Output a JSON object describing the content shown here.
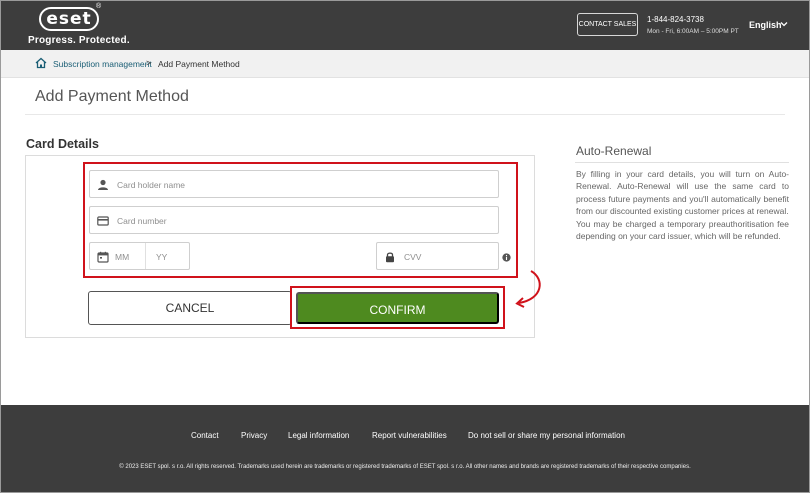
{
  "header": {
    "logo_text": "eset",
    "logo_registered": "®",
    "tagline": "Progress. Protected.",
    "contact_sales_label": "CONTACT SALES",
    "phone": "1-844-824-3738",
    "hours": "Mon - Fri, 6:00AM – 5:00PM PT",
    "language": "English"
  },
  "breadcrumb": {
    "link_label": "Subscription management",
    "separator": ">",
    "current": "Add Payment Method"
  },
  "page_title": "Add Payment Method",
  "card_details": {
    "heading": "Card Details",
    "card_holder_placeholder": "Card holder name",
    "card_number_placeholder": "Card number",
    "month_placeholder": "MM",
    "year_placeholder": "YY",
    "cvv_placeholder": "CVV"
  },
  "buttons": {
    "cancel": "CANCEL",
    "confirm": "CONFIRM"
  },
  "auto_renewal": {
    "title": "Auto-Renewal",
    "paragraph1": "By filling in your card details, you will turn on Auto-Renewal. Auto-Renewal will use the same card to process future payments and you'll automatically benefit from our discounted existing customer prices at renewal.",
    "paragraph2": "You may be charged a temporary preauthoritisation fee depending on your card issuer, which will be refunded."
  },
  "footer": {
    "links": [
      "Contact",
      "Privacy",
      "Legal information",
      "Report vulnerabilities",
      "Do not sell or share my personal information"
    ],
    "copyright": "© 2023 ESET spol. s r.o. All rights reserved. Trademarks used herein are trademarks or registered trademarks of ESET spol. s r.o. All other names and brands are registered trademarks of their respective companies."
  },
  "colors": {
    "header_bg": "#3d3d3d",
    "confirm_green": "#4e8a1f",
    "highlight_red": "#d0121b",
    "link_teal": "#1a5e75"
  },
  "icons": [
    "home-icon",
    "person-icon",
    "credit-card-icon",
    "calendar-icon",
    "lock-icon",
    "info-icon",
    "chevron-down-icon",
    "curved-arrow-icon"
  ]
}
